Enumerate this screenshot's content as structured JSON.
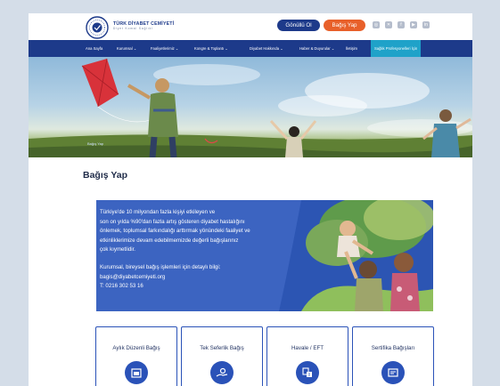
{
  "brand": {
    "name": "TÜRK DİYABET CEMİYETİ",
    "tagline": "Diyet Komal Sağlıkl"
  },
  "header": {
    "volunteer_label": "Gönüllü Ol",
    "donate_label": "Bağış Yap"
  },
  "nav": {
    "items": [
      {
        "label": "Ana Sayfa"
      },
      {
        "label": "Kurumsal ⌄"
      },
      {
        "label": "Faaliyetlerimiz ⌄"
      },
      {
        "label": "Kongre & Toplantı ⌄"
      },
      {
        "label": "Diyabet Hakkında ⌄"
      },
      {
        "label": "Haber & Duyurular ⌄"
      },
      {
        "label": "İletişim"
      },
      {
        "label": "Sağlık Profesyonelleri İçin"
      }
    ]
  },
  "hero": {
    "breadcrumb": "Bağış Yap"
  },
  "page": {
    "title": "Bağış Yap"
  },
  "banner": {
    "lines": [
      "Türkiye'de 10 milyondan fazla kişiyi etkileyen ve",
      "son on yılda %90'dan fazla artış gösteren diyabet hastalığını",
      "önlemek, toplumsal farkındalığı arttırmak yönündeki faaliyet ve",
      "etkinliklerimize devam edebilmemizde değerli bağışlarınız",
      "çok kıymetlidir."
    ],
    "contact_lines": [
      "Kurumsal, bireysel bağış işlemleri için detaylı bilgi:",
      "bagis@diyabetcemiyeti.org",
      "T: 0216 302 53 16"
    ]
  },
  "cards": [
    {
      "label": "Aylık Düzenli Bağış",
      "icon": "calendar-icon"
    },
    {
      "label": "Tek Seferlik Bağış",
      "icon": "hand-coin-icon"
    },
    {
      "label": "Havale / EFT",
      "icon": "bank-transfer-icon"
    },
    {
      "label": "Sertifika Bağışları",
      "icon": "certificate-icon"
    }
  ],
  "colors": {
    "navy": "#1d3a8a",
    "orange": "#e8602a",
    "banner": "#3c64c1",
    "active_nav": "#1fa2c9"
  }
}
